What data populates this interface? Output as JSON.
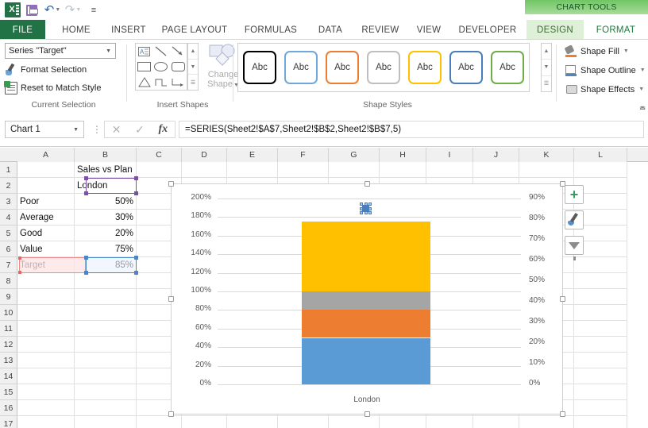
{
  "quick_access": {
    "app_icon": "excel-logo-icon",
    "buttons": [
      {
        "name": "save-icon",
        "label": "Save"
      },
      {
        "name": "undo-icon",
        "label": "Undo"
      },
      {
        "name": "redo-icon",
        "label": "Redo"
      },
      {
        "name": "customize-qat-icon",
        "label": "Customize Quick Access Toolbar"
      }
    ]
  },
  "contextual_banner": {
    "title": "CHART TOOLS"
  },
  "tabs": [
    {
      "label": "FILE",
      "type": "file"
    },
    {
      "label": "HOME",
      "type": "normal"
    },
    {
      "label": "INSERT",
      "type": "normal"
    },
    {
      "label": "PAGE LAYOUT",
      "type": "normal"
    },
    {
      "label": "FORMULAS",
      "type": "normal"
    },
    {
      "label": "DATA",
      "type": "normal"
    },
    {
      "label": "REVIEW",
      "type": "normal"
    },
    {
      "label": "VIEW",
      "type": "normal"
    },
    {
      "label": "DEVELOPER",
      "type": "normal"
    },
    {
      "label": "DESIGN",
      "type": "context"
    },
    {
      "label": "FORMAT",
      "type": "context-active"
    }
  ],
  "ribbon": {
    "current_selection": {
      "group_label": "Current Selection",
      "selector_value": "Series \"Target\"",
      "format_selection": "Format Selection",
      "reset_to_match_style": "Reset to Match Style"
    },
    "insert_shapes": {
      "group_label": "Insert Shapes",
      "shapes": [
        "textbox-shape",
        "line-shape",
        "arrow-shape",
        "rectangle-shape",
        "oval-shape",
        "rounded-rectangle-shape",
        "triangle-shape",
        "elbow-connector-shape",
        "elbow-arrow-connector-shape"
      ],
      "change_shape_line1": "Change",
      "change_shape_line2": "Shape"
    },
    "shape_styles": {
      "group_label": "Shape Styles",
      "items": [
        {
          "label": "Abc",
          "outline": "#000000"
        },
        {
          "label": "Abc",
          "outline": "#6fa8dc"
        },
        {
          "label": "Abc",
          "outline": "#ed7d31"
        },
        {
          "label": "Abc",
          "outline": "#bfbfbf"
        },
        {
          "label": "Abc",
          "outline": "#ffc000"
        },
        {
          "label": "Abc",
          "outline": "#4a7ebb"
        },
        {
          "label": "Abc",
          "outline": "#70ad47"
        }
      ],
      "shape_fill": "Shape Fill",
      "shape_outline": "Shape Outline",
      "shape_effects": "Shape Effects"
    }
  },
  "formula_bar": {
    "name_box": "Chart 1",
    "cancel_icon": "cancel-icon",
    "enter_icon": "enter-icon",
    "function_icon": "insert-function-icon",
    "formula": "=SERIES(Sheet2!$A$7,Sheet2!$B$2,Sheet2!$B$7,5)"
  },
  "sheet": {
    "columns": [
      "A",
      "B",
      "C",
      "D",
      "E",
      "F",
      "G",
      "H",
      "I",
      "J",
      "K",
      "L"
    ],
    "rows": [
      "1",
      "2",
      "3",
      "4",
      "5",
      "6",
      "7",
      "8",
      "9",
      "10",
      "11",
      "12",
      "13",
      "14",
      "15",
      "16",
      "17"
    ],
    "cells": [
      {
        "row": 1,
        "col": "B",
        "value": "Sales vs Plan",
        "align": "left"
      },
      {
        "row": 2,
        "col": "B",
        "value": "London",
        "align": "left"
      },
      {
        "row": 3,
        "col": "A",
        "value": "Poor",
        "align": "left"
      },
      {
        "row": 3,
        "col": "B",
        "value": "50%",
        "align": "right"
      },
      {
        "row": 4,
        "col": "A",
        "value": "Average",
        "align": "left"
      },
      {
        "row": 4,
        "col": "B",
        "value": "30%",
        "align": "right"
      },
      {
        "row": 5,
        "col": "A",
        "value": "Good",
        "align": "left"
      },
      {
        "row": 5,
        "col": "B",
        "value": "20%",
        "align": "right"
      },
      {
        "row": 6,
        "col": "A",
        "value": "Value",
        "align": "left"
      },
      {
        "row": 6,
        "col": "B",
        "value": "75%",
        "align": "right"
      },
      {
        "row": 7,
        "col": "A",
        "value": "Target",
        "align": "left"
      },
      {
        "row": 7,
        "col": "B",
        "value": "85%",
        "align": "right"
      }
    ],
    "highlights": {
      "category_ref": {
        "cell": "B2",
        "color": "#7f4fa8"
      },
      "name_ref": {
        "cell": "A7",
        "color": "#e06666"
      },
      "value_ref": {
        "cell": "B7",
        "color": "#4a86c8"
      }
    }
  },
  "chart": {
    "selected_element": "Series \"Target\" marker",
    "floating_buttons": [
      {
        "name": "chart-elements-button",
        "icon": "plus-icon"
      },
      {
        "name": "chart-styles-button",
        "icon": "brush-icon"
      },
      {
        "name": "chart-filters-button",
        "icon": "funnel-icon"
      }
    ]
  },
  "chart_data": {
    "type": "bar",
    "title": "",
    "categories": [
      "London"
    ],
    "stacked": true,
    "series": [
      {
        "name": "Poor",
        "values": [
          50
        ],
        "color": "#5b9bd5",
        "axis": "primary"
      },
      {
        "name": "Average",
        "values": [
          30
        ],
        "color": "#ed7d31",
        "axis": "primary"
      },
      {
        "name": "Good",
        "values": [
          20
        ],
        "color": "#a5a5a5",
        "axis": "primary"
      },
      {
        "name": "Value",
        "values": [
          75
        ],
        "color": "#ffc000",
        "axis": "primary"
      },
      {
        "name": "Target",
        "values": [
          85
        ],
        "color": "#4a7ebb",
        "axis": "secondary",
        "marker": "square"
      }
    ],
    "primary_axis": {
      "ylabel": "",
      "ylim": [
        0,
        200
      ],
      "tick_step": 20,
      "ticks": [
        "0%",
        "20%",
        "40%",
        "60%",
        "80%",
        "100%",
        "120%",
        "140%",
        "160%",
        "180%",
        "200%"
      ]
    },
    "secondary_axis": {
      "ylabel": "",
      "ylim": [
        0,
        90
      ],
      "tick_step": 10,
      "ticks": [
        "0%",
        "10%",
        "20%",
        "30%",
        "40%",
        "50%",
        "60%",
        "70%",
        "80%",
        "90%"
      ]
    },
    "xlabel": "",
    "grid": true,
    "legend": "none"
  }
}
